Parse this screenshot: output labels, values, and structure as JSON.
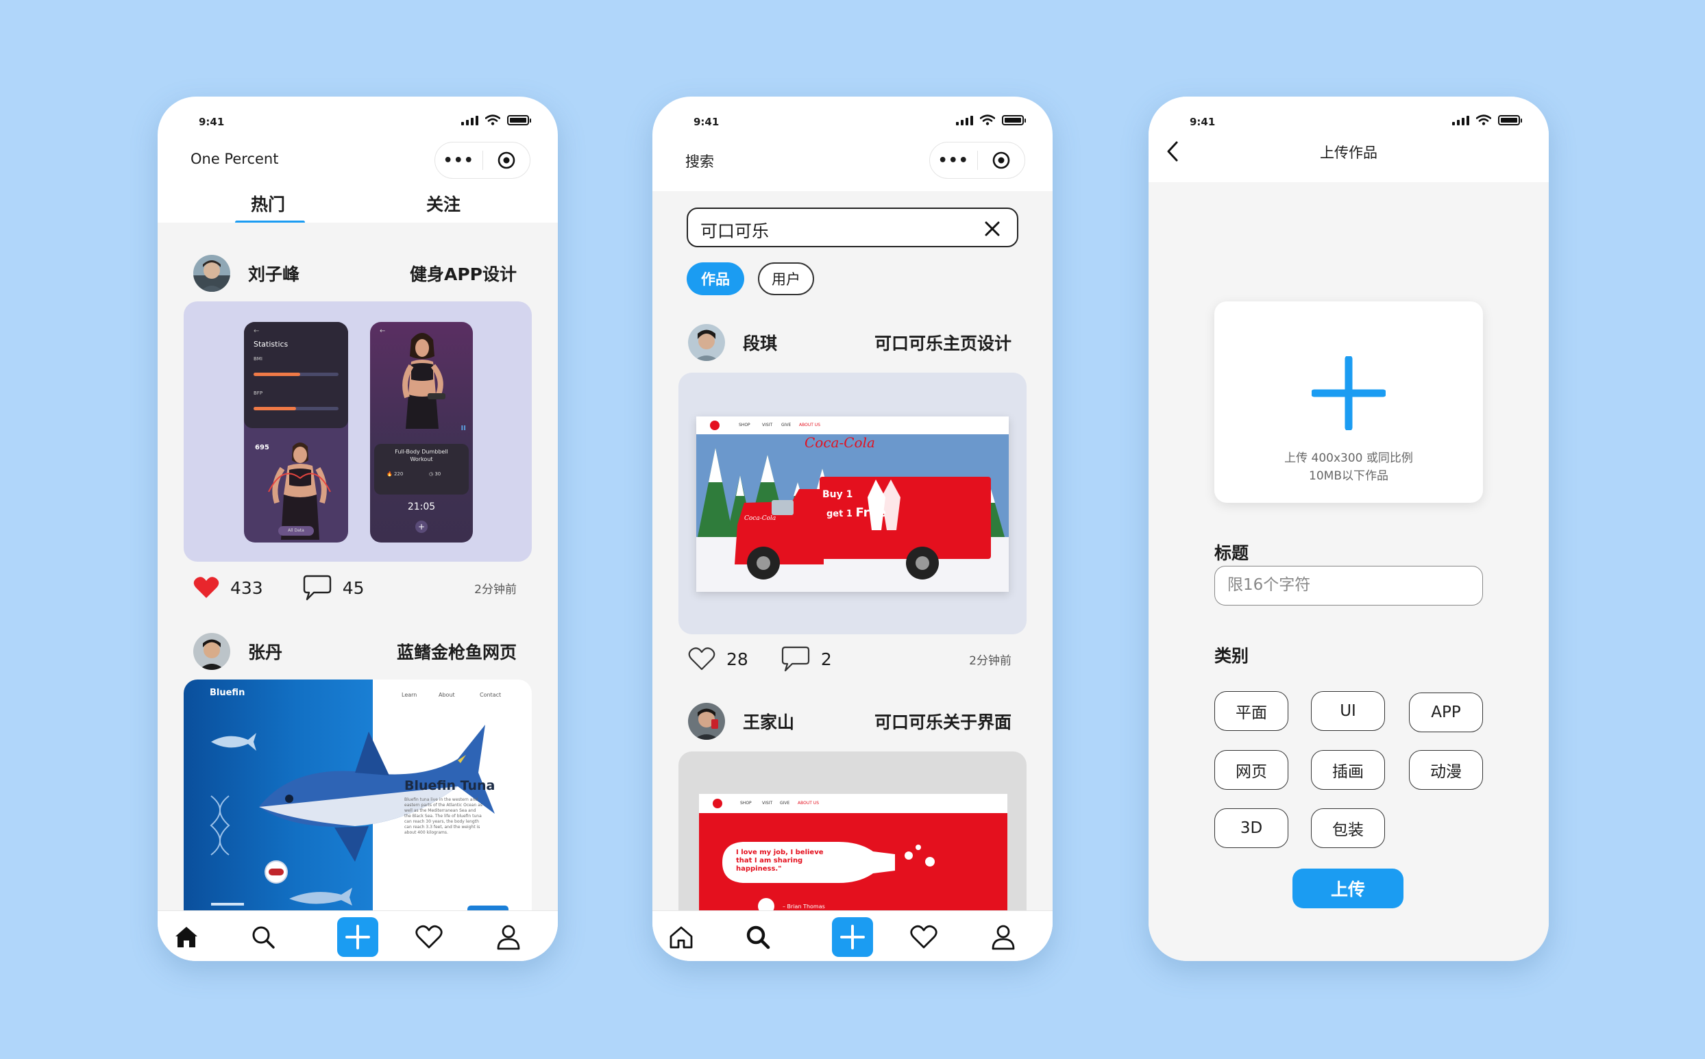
{
  "status_time": "9:41",
  "feed": {
    "app_title": "One Percent",
    "tabs": [
      "热门",
      "关注"
    ],
    "posts": [
      {
        "user": "刘子峰",
        "title": "健身APP设计",
        "likes": "433",
        "comments": "45",
        "time": "2分钟前",
        "artwork": {
          "stats_title": "Statistics",
          "bmi_label": "BMI",
          "bfp_label": "BFP",
          "calories": "695",
          "workout_name": "Full-Body Dumbbell Workout",
          "cal_small": "220",
          "min_small": "30",
          "timer": "21:05",
          "btn": "All Data"
        }
      },
      {
        "user": "张丹",
        "title": "蓝鳍金枪鱼网页",
        "artwork": {
          "logo": "Bluefin",
          "nav": [
            "Learn",
            "About",
            "Contact"
          ],
          "heading": "Bluefin Tuna",
          "body": "Bluefin tuna live in the western and eastern parts of the Atlantic Ocean as well as the Mediterranean Sea and the Black Sea. The life of bluefin tuna can reach 30 years, the body length can reach 3.3 feet, and the weight is about 400 kilograms."
        }
      }
    ]
  },
  "search": {
    "page_title": "搜索",
    "query": "可口可乐",
    "filters": [
      "作品",
      "用户"
    ],
    "posts": [
      {
        "user": "段琪",
        "title": "可口可乐主页设计",
        "likes": "28",
        "comments": "2",
        "time": "2分钟前",
        "artwork": {
          "brand": "Coca-Cola",
          "nav": [
            "SHOP",
            "VISIT",
            "GIVE",
            "ABOUT US"
          ],
          "promo_line1": "Buy 1",
          "promo_line2": "get 1",
          "promo_free": "Free"
        }
      },
      {
        "user": "王家山",
        "title": "可口可乐关于界面",
        "artwork": {
          "nav": [
            "SHOP",
            "VISIT",
            "GIVE",
            "ABOUT US"
          ],
          "quote": "I love my job, I believe that I am sharing happiness.\"",
          "author": "– Brian Thomas"
        }
      }
    ]
  },
  "upload": {
    "page_title": "上传作品",
    "hint_line1": "上传 400x300 或同比例",
    "hint_line2": "10MB以下作品",
    "title_label": "标题",
    "title_placeholder": "限16个字符",
    "category_label": "类别",
    "categories": [
      "平面",
      "UI",
      "APP",
      "网页",
      "插画",
      "动漫",
      "3D",
      "包装"
    ],
    "submit_label": "上传"
  },
  "colors": {
    "accent": "#1b9cf2",
    "background": "#b0d6fa",
    "like_red": "#e8262c",
    "coca_red": "#e4101e"
  },
  "icons": [
    "home-icon",
    "search-icon",
    "plus-icon",
    "heart-icon",
    "profile-icon",
    "more-dots-icon",
    "target-icon",
    "back-icon",
    "close-icon",
    "comment-icon"
  ]
}
